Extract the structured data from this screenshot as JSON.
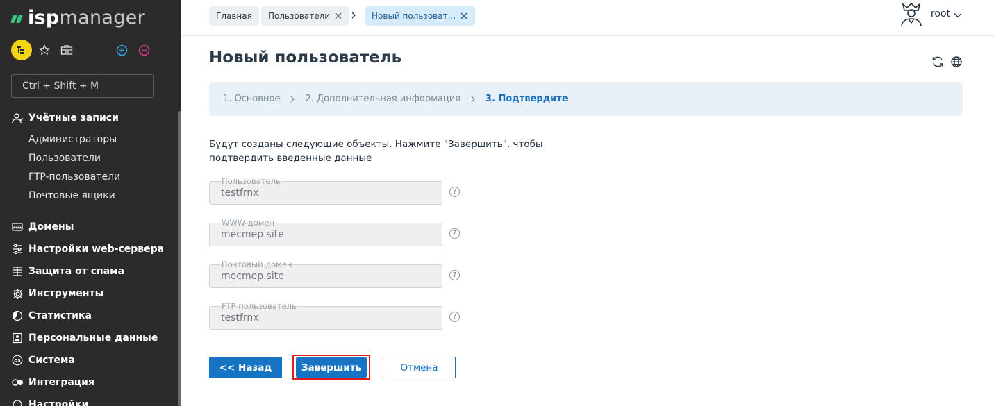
{
  "app": {
    "logo_bold": "isp",
    "logo_light": "manager"
  },
  "sidebar": {
    "search_placeholder": "Ctrl + Shift + M",
    "sections": [
      {
        "label": "Учётные записи",
        "icon": "users-icon"
      },
      {
        "label": "Домены",
        "icon": "domain-icon"
      },
      {
        "label": "Настройки web-сервера",
        "icon": "sliders-icon"
      },
      {
        "label": "Защита от спама",
        "icon": "filter-icon"
      },
      {
        "label": "Инструменты",
        "icon": "gear-icon"
      },
      {
        "label": "Статистика",
        "icon": "pie-chart-icon"
      },
      {
        "label": "Персональные данные",
        "icon": "id-card-icon"
      },
      {
        "label": "Система",
        "icon": "os-icon"
      },
      {
        "label": "Интеграция",
        "icon": "integration-icon"
      },
      {
        "label": "Настройки",
        "icon": "settings-icon"
      }
    ],
    "accounts_items": [
      "Администраторы",
      "Пользователи",
      "FTP-пользователи",
      "Почтовые ящики"
    ]
  },
  "topbar": {
    "tabs": [
      {
        "label": "Главная"
      },
      {
        "label": "Пользователи"
      },
      {
        "label": "Новый пользоват..."
      }
    ],
    "user": "root"
  },
  "main": {
    "title": "Новый пользователь",
    "steps": [
      "1. Основное",
      "2. Дополнительная информация",
      "3. Подтвердите"
    ],
    "description": "Будут созданы следующие объекты. Нажмите \"Завершить\", чтобы подтвердить введенные данные",
    "fields": [
      {
        "label": "Пользователь",
        "value": "testfrnx"
      },
      {
        "label": "WWW-домен",
        "value": "mecmep.site"
      },
      {
        "label": "Почтовый домен",
        "value": "mecmep.site"
      },
      {
        "label": "FTP-пользователь",
        "value": "testfrnx"
      }
    ],
    "help_symbol": "?",
    "buttons": {
      "back": "<< Назад",
      "finish": "Завершить",
      "cancel": "Отмена"
    }
  },
  "colors": {
    "accent": "#1574c4",
    "sidebar_bg": "#2b2b2b",
    "highlight_border": "#e11b1b"
  }
}
